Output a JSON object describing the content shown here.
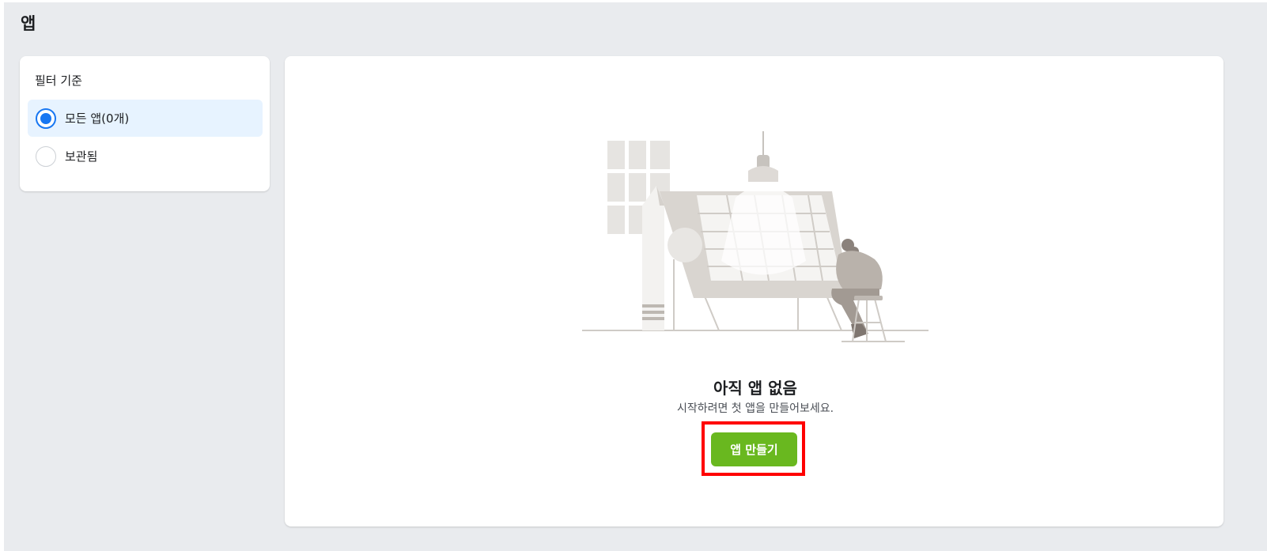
{
  "page": {
    "title": "앱"
  },
  "filter": {
    "heading": "필터 기준",
    "options": [
      {
        "label": "모든 앱(0개)",
        "selected": true
      },
      {
        "label": "보관됨",
        "selected": false
      }
    ]
  },
  "empty_state": {
    "title": "아직 앱 없음",
    "subtitle": "시작하려면 첫 앱을 만들어보세요.",
    "create_button_label": "앱 만들기",
    "illustration_icon": "lightbulb-drafting-illustration"
  },
  "colors": {
    "accent": "#1877f2",
    "button": "#69b81f",
    "highlight_outline": "#ff0000",
    "selected_background": "#e7f3ff"
  }
}
